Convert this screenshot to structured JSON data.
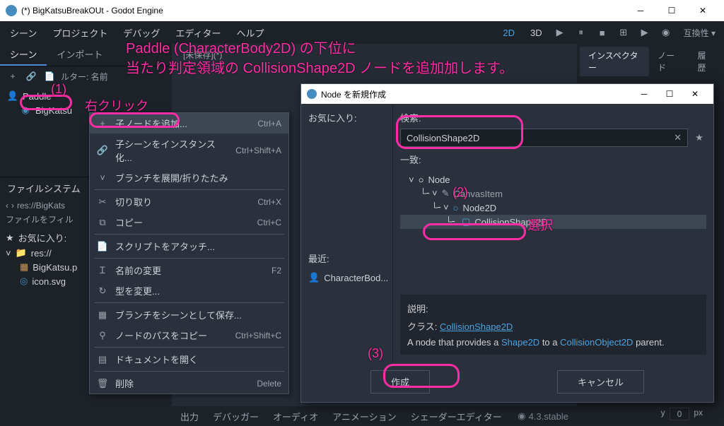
{
  "window": {
    "title": "(*) BigKatsuBreakOUt - Godot Engine"
  },
  "menu": {
    "scene": "シーン",
    "project": "プロジェクト",
    "debug": "デバッグ",
    "editor": "エディター",
    "help": "ヘルプ",
    "2d": "2D",
    "3d": "3D",
    "compat": "互換性 ▾"
  },
  "annotations": {
    "main_line1": "Paddle (CharacterBody2D) の下位に",
    "main_line2": "当たり判定領域の CollisionShape2D ノードを追加加します。",
    "step1": "(1)",
    "rightclick": "右クリック",
    "step2": "(2)",
    "select": "選択",
    "step3": "(3)"
  },
  "scene_panel": {
    "tab_scene": "シーン",
    "tab_import": "インポート",
    "filter_label": "ルター: 名前",
    "paddle": "Paddle",
    "bigkatsu": "BigKatsu"
  },
  "context_menu": {
    "add_child": "子ノードを追加...",
    "add_child_sc": "Ctrl+A",
    "instance": "子シーンをインスタンス化...",
    "instance_sc": "Ctrl+Shift+A",
    "expand": "ブランチを展開/折りたたみ",
    "cut": "切り取り",
    "cut_sc": "Ctrl+X",
    "copy": "コピー",
    "copy_sc": "Ctrl+C",
    "attach_script": "スクリプトをアタッチ...",
    "rename": "名前の変更",
    "rename_sc": "F2",
    "change_type": "型を変更...",
    "save_branch": "ブランチをシーンとして保存...",
    "copy_path": "ノードのパスをコピー",
    "copy_path_sc": "Ctrl+Shift+C",
    "open_docs": "ドキュメントを開く",
    "delete": "削除",
    "delete_sc": "Delete"
  },
  "dialog": {
    "title": "Node を新規作成",
    "favorites": "お気に入り:",
    "search_label": "検索:",
    "search_value": "CollisionShape2D",
    "matches": "一致:",
    "node": "Node",
    "canvasitem": "CanvasItem",
    "node2d": "Node2D",
    "collisionshape2d": "CollisionShape2D",
    "recent": "最近:",
    "recent_item": "CharacterBod...",
    "desc_label": "説明:",
    "class_label": "クラス:",
    "class_name": "CollisionShape2D",
    "desc_text1": "A node that provides a ",
    "desc_hl1": "Shape2D",
    "desc_text2": " to a ",
    "desc_hl2": "CollisionObject2D",
    "desc_text3": " parent.",
    "create": "作成",
    "cancel": "キャンセル"
  },
  "fs_panel": {
    "header": "ファイルシステム",
    "path": "res://BigKats",
    "filter": "ファイルをフィル",
    "fav": "お気に入り:",
    "res": "res://",
    "file1": "BigKatsu.p",
    "file2": "icon.svg"
  },
  "inspector": {
    "tab": "インスペクター",
    "tab_node": "ノード",
    "tab_history": "履歴"
  },
  "bottom": {
    "output": "出力",
    "debugger": "デバッガー",
    "audio": "オーディオ",
    "animation": "アニメーション",
    "shader": "シェーダーエディター",
    "version": "4.3.stable"
  },
  "coords": {
    "y": "y",
    "yval": "0",
    "px": "px"
  }
}
